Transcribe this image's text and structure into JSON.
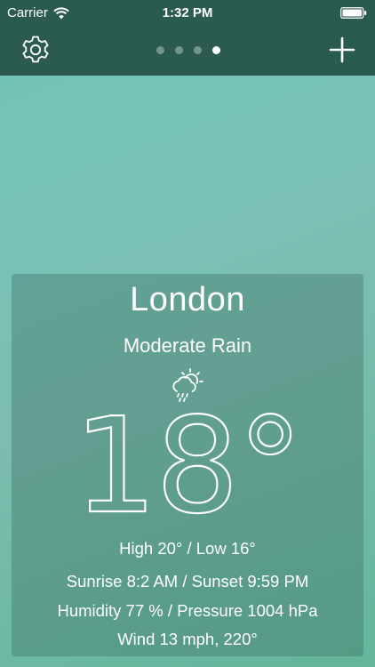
{
  "status_bar": {
    "carrier": "Carrier",
    "time": "1:32 PM",
    "wifi_icon": "wifi-icon",
    "battery_icon": "battery-icon"
  },
  "nav": {
    "settings_icon": "gear-icon",
    "add_icon": "plus-icon",
    "page_count": 4,
    "active_page": 4
  },
  "weather": {
    "city": "London",
    "condition": "Moderate Rain",
    "condition_icon": "sun-cloud-rain-icon",
    "temperature": "18",
    "degree_symbol": "°",
    "high_low": "High 20° / Low 16°",
    "sun_times": "Sunrise 8:2 AM / Sunset 9:59 PM",
    "humidity_pressure": "Humidity 77 % / Pressure 1004 hPa",
    "wind": "Wind 13 mph, 220°"
  },
  "colors": {
    "header": "#2a5a50",
    "background_top": "#6fc3b7",
    "background_bottom": "#64b59b",
    "text": "#ffffff"
  }
}
